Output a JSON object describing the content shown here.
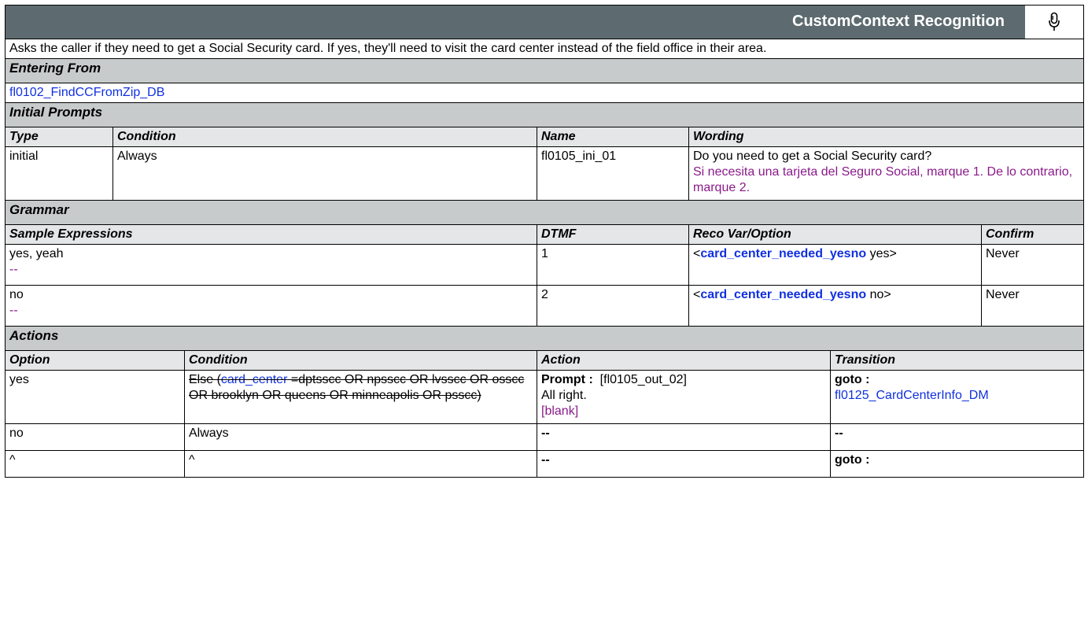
{
  "header": {
    "title": "CustomContext Recognition",
    "icon": "microphone-icon"
  },
  "description": "Asks the caller if they need to get a Social Security card.  If yes, they'll need to visit the card center instead of the field office in their area.",
  "entering_from": {
    "heading": "Entering From",
    "link": "fl0102_FindCCFromZip_DB"
  },
  "initial_prompts": {
    "heading": "Initial Prompts",
    "columns": [
      "Type",
      "Condition",
      "Name",
      "Wording"
    ],
    "row": {
      "type": "initial",
      "condition": "Always",
      "name": "fl0105_ini_01",
      "wording_en": "Do you need to get a Social Security card?",
      "wording_es": "Si necesita una tarjeta del Seguro Social, marque 1. De lo contrario, marque 2."
    }
  },
  "grammar": {
    "heading": "Grammar",
    "columns": [
      "Sample Expressions",
      "DTMF",
      "Reco Var/Option",
      "Confirm"
    ],
    "rows": [
      {
        "expr": "yes, yeah",
        "expr_es": "--",
        "dtmf": "1",
        "var_open": "<",
        "var": "card_center_needed_yesno",
        "var_val": " yes>",
        "confirm": "Never"
      },
      {
        "expr": "no",
        "expr_es": "--",
        "dtmf": "2",
        "var_open": "<",
        "var": "card_center_needed_yesno",
        "var_val": " no>",
        "confirm": "Never"
      }
    ]
  },
  "actions": {
    "heading": "Actions",
    "columns": [
      "Option",
      "Condition",
      "Action",
      "Transition"
    ],
    "rows": [
      {
        "option": "yes",
        "cond_pre": "Else (",
        "cond_link": "card_center",
        "cond_post": " =dptsscc OR npsscc OR lvsscc OR osscc OR brooklyn OR queens OR minneapolis OR psscc)",
        "prompt_label": "Prompt :",
        "prompt_id": "  [fl0105_out_02]",
        "prompt_text": "All right.",
        "prompt_es": "[blank]",
        "goto_label": "goto :",
        "goto_link": "fl0125_CardCenterInfo_DM"
      },
      {
        "option": "no",
        "condition": "Always",
        "action": "--",
        "transition": "--"
      },
      {
        "option": "^",
        "condition": "^",
        "action": "--",
        "transition": "goto :"
      }
    ]
  }
}
